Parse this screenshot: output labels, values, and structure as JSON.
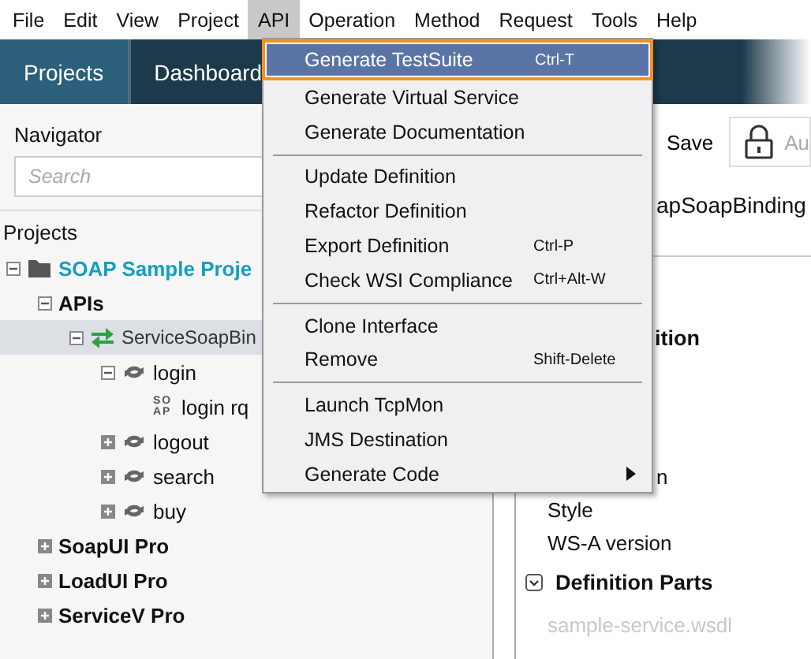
{
  "menubar": [
    {
      "label": "File",
      "selected": false
    },
    {
      "label": "Edit",
      "selected": false
    },
    {
      "label": "View",
      "selected": false
    },
    {
      "label": "Project",
      "selected": false
    },
    {
      "label": "API",
      "selected": true
    },
    {
      "label": "Operation",
      "selected": false
    },
    {
      "label": "Method",
      "selected": false
    },
    {
      "label": "Request",
      "selected": false
    },
    {
      "label": "Tools",
      "selected": false
    },
    {
      "label": "Help",
      "selected": false
    }
  ],
  "tabs": [
    {
      "label": "Projects",
      "selected": true
    },
    {
      "label": "Dashboard",
      "selected": false
    }
  ],
  "navigator": {
    "title": "Navigator",
    "search": {
      "placeholder": "Search"
    },
    "tree_title": "Projects",
    "tree": [
      {
        "kind": "project",
        "label": "SOAP Sample Proje",
        "expanded": true,
        "selected": false,
        "children": [
          {
            "kind": "folder",
            "label": "APIs",
            "expanded": true,
            "selected": false,
            "children": [
              {
                "kind": "interface",
                "label": "ServiceSoapBin",
                "expanded": true,
                "selected": true,
                "children": [
                  {
                    "kind": "operation",
                    "label": "login",
                    "expanded": true,
                    "selected": false,
                    "children": [
                      {
                        "kind": "request",
                        "label": "login rq",
                        "badge": "SOAP",
                        "selected": false
                      }
                    ]
                  },
                  {
                    "kind": "operation",
                    "label": "logout",
                    "expanded": false,
                    "selected": false
                  },
                  {
                    "kind": "operation",
                    "label": "search",
                    "expanded": false,
                    "selected": false
                  },
                  {
                    "kind": "operation",
                    "label": "buy",
                    "expanded": false,
                    "selected": false
                  }
                ]
              }
            ]
          },
          {
            "kind": "folder",
            "label": "SoapUI Pro",
            "expanded": false,
            "selected": false
          },
          {
            "kind": "folder",
            "label": "LoadUI Pro",
            "expanded": false,
            "selected": false
          },
          {
            "kind": "folder",
            "label": "ServiceV Pro",
            "expanded": false,
            "selected": false
          }
        ]
      }
    ]
  },
  "editor": {
    "save": "Save",
    "lock": "Au",
    "title": "apSoapBinding",
    "section": "ition",
    "rows": [
      "n",
      "Style",
      "WS-A version"
    ],
    "parts": {
      "label": "Definition Parts",
      "expanded": true
    },
    "file": "sample-service.wsdl"
  },
  "menu": [
    {
      "kind": "item",
      "label": "Generate TestSuite",
      "shortcut": "Ctrl-T",
      "selected": true
    },
    {
      "kind": "item",
      "label": "Generate Virtual Service",
      "selected": false
    },
    {
      "kind": "item",
      "label": "Generate Documentation",
      "selected": false
    },
    {
      "kind": "separator"
    },
    {
      "kind": "item",
      "label": "Update Definition",
      "selected": false
    },
    {
      "kind": "item",
      "label": "Refactor Definition",
      "selected": false
    },
    {
      "kind": "item",
      "label": "Export Definition",
      "shortcut": "Ctrl-P",
      "selected": false
    },
    {
      "kind": "item",
      "label": "Check WSI Compliance",
      "shortcut": "Ctrl+Alt-W",
      "selected": false
    },
    {
      "kind": "separator"
    },
    {
      "kind": "item",
      "label": "Clone Interface",
      "selected": false
    },
    {
      "kind": "item",
      "label": "Remove",
      "shortcut": "Shift-Delete",
      "selected": false
    },
    {
      "kind": "separator"
    },
    {
      "kind": "item",
      "label": "Launch TcpMon",
      "selected": false
    },
    {
      "kind": "item",
      "label": "JMS Destination",
      "selected": false
    },
    {
      "kind": "item",
      "label": "Generate Code",
      "submenu": true,
      "selected": false
    }
  ]
}
